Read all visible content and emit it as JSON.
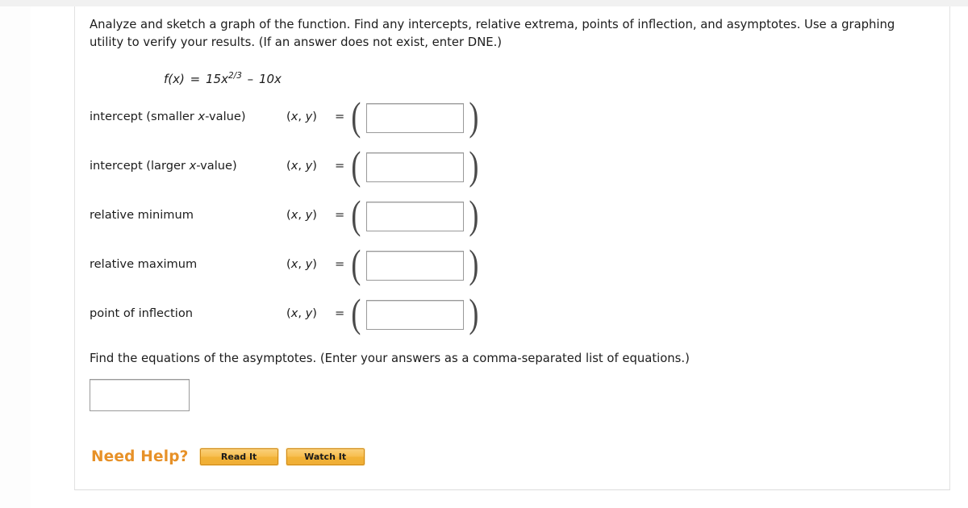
{
  "question": {
    "prompt": "Analyze and sketch a graph of the function. Find any intercepts, relative extrema, points of inflection, and asymptotes. Use a graphing utility to verify your results. (If an answer does not exist, enter DNE.)",
    "formula": {
      "lhs": "f(x)",
      "equals": "=",
      "coefficient": "15x",
      "exponent": "2/3",
      "operator": "–",
      "term2": "10x",
      "plain": "f(x) = 15x^(2/3) – 10x"
    }
  },
  "answer_rows": [
    {
      "label_a": "intercept (smaller ",
      "label_it": "x",
      "label_b": "-value)",
      "pair": "(x, y)",
      "equals": "=",
      "value": "",
      "placeholder": ""
    },
    {
      "label_a": "intercept (larger ",
      "label_it": "x",
      "label_b": "-value)",
      "pair": "(x, y)",
      "equals": "=",
      "value": "",
      "placeholder": ""
    },
    {
      "label_a": "relative minimum",
      "label_it": "",
      "label_b": "",
      "pair": "(x, y)",
      "equals": "=",
      "value": "",
      "placeholder": ""
    },
    {
      "label_a": "relative maximum",
      "label_it": "",
      "label_b": "",
      "pair": "(x, y)",
      "equals": "=",
      "value": "",
      "placeholder": ""
    },
    {
      "label_a": "point of inflection",
      "label_it": "",
      "label_b": "",
      "pair": "(x, y)",
      "equals": "=",
      "value": "",
      "placeholder": ""
    }
  ],
  "paren": {
    "left": "(",
    "right": ")"
  },
  "asymptotes": {
    "prompt": "Find the equations of the asymptotes. (Enter your answers as a comma-separated list of equations.)",
    "value": "",
    "placeholder": ""
  },
  "help": {
    "title": "Need Help?",
    "buttons": [
      {
        "label": "Read It"
      },
      {
        "label": "Watch It"
      }
    ],
    "accent_color": "#E79128",
    "button_border_color": "#D08A18"
  }
}
